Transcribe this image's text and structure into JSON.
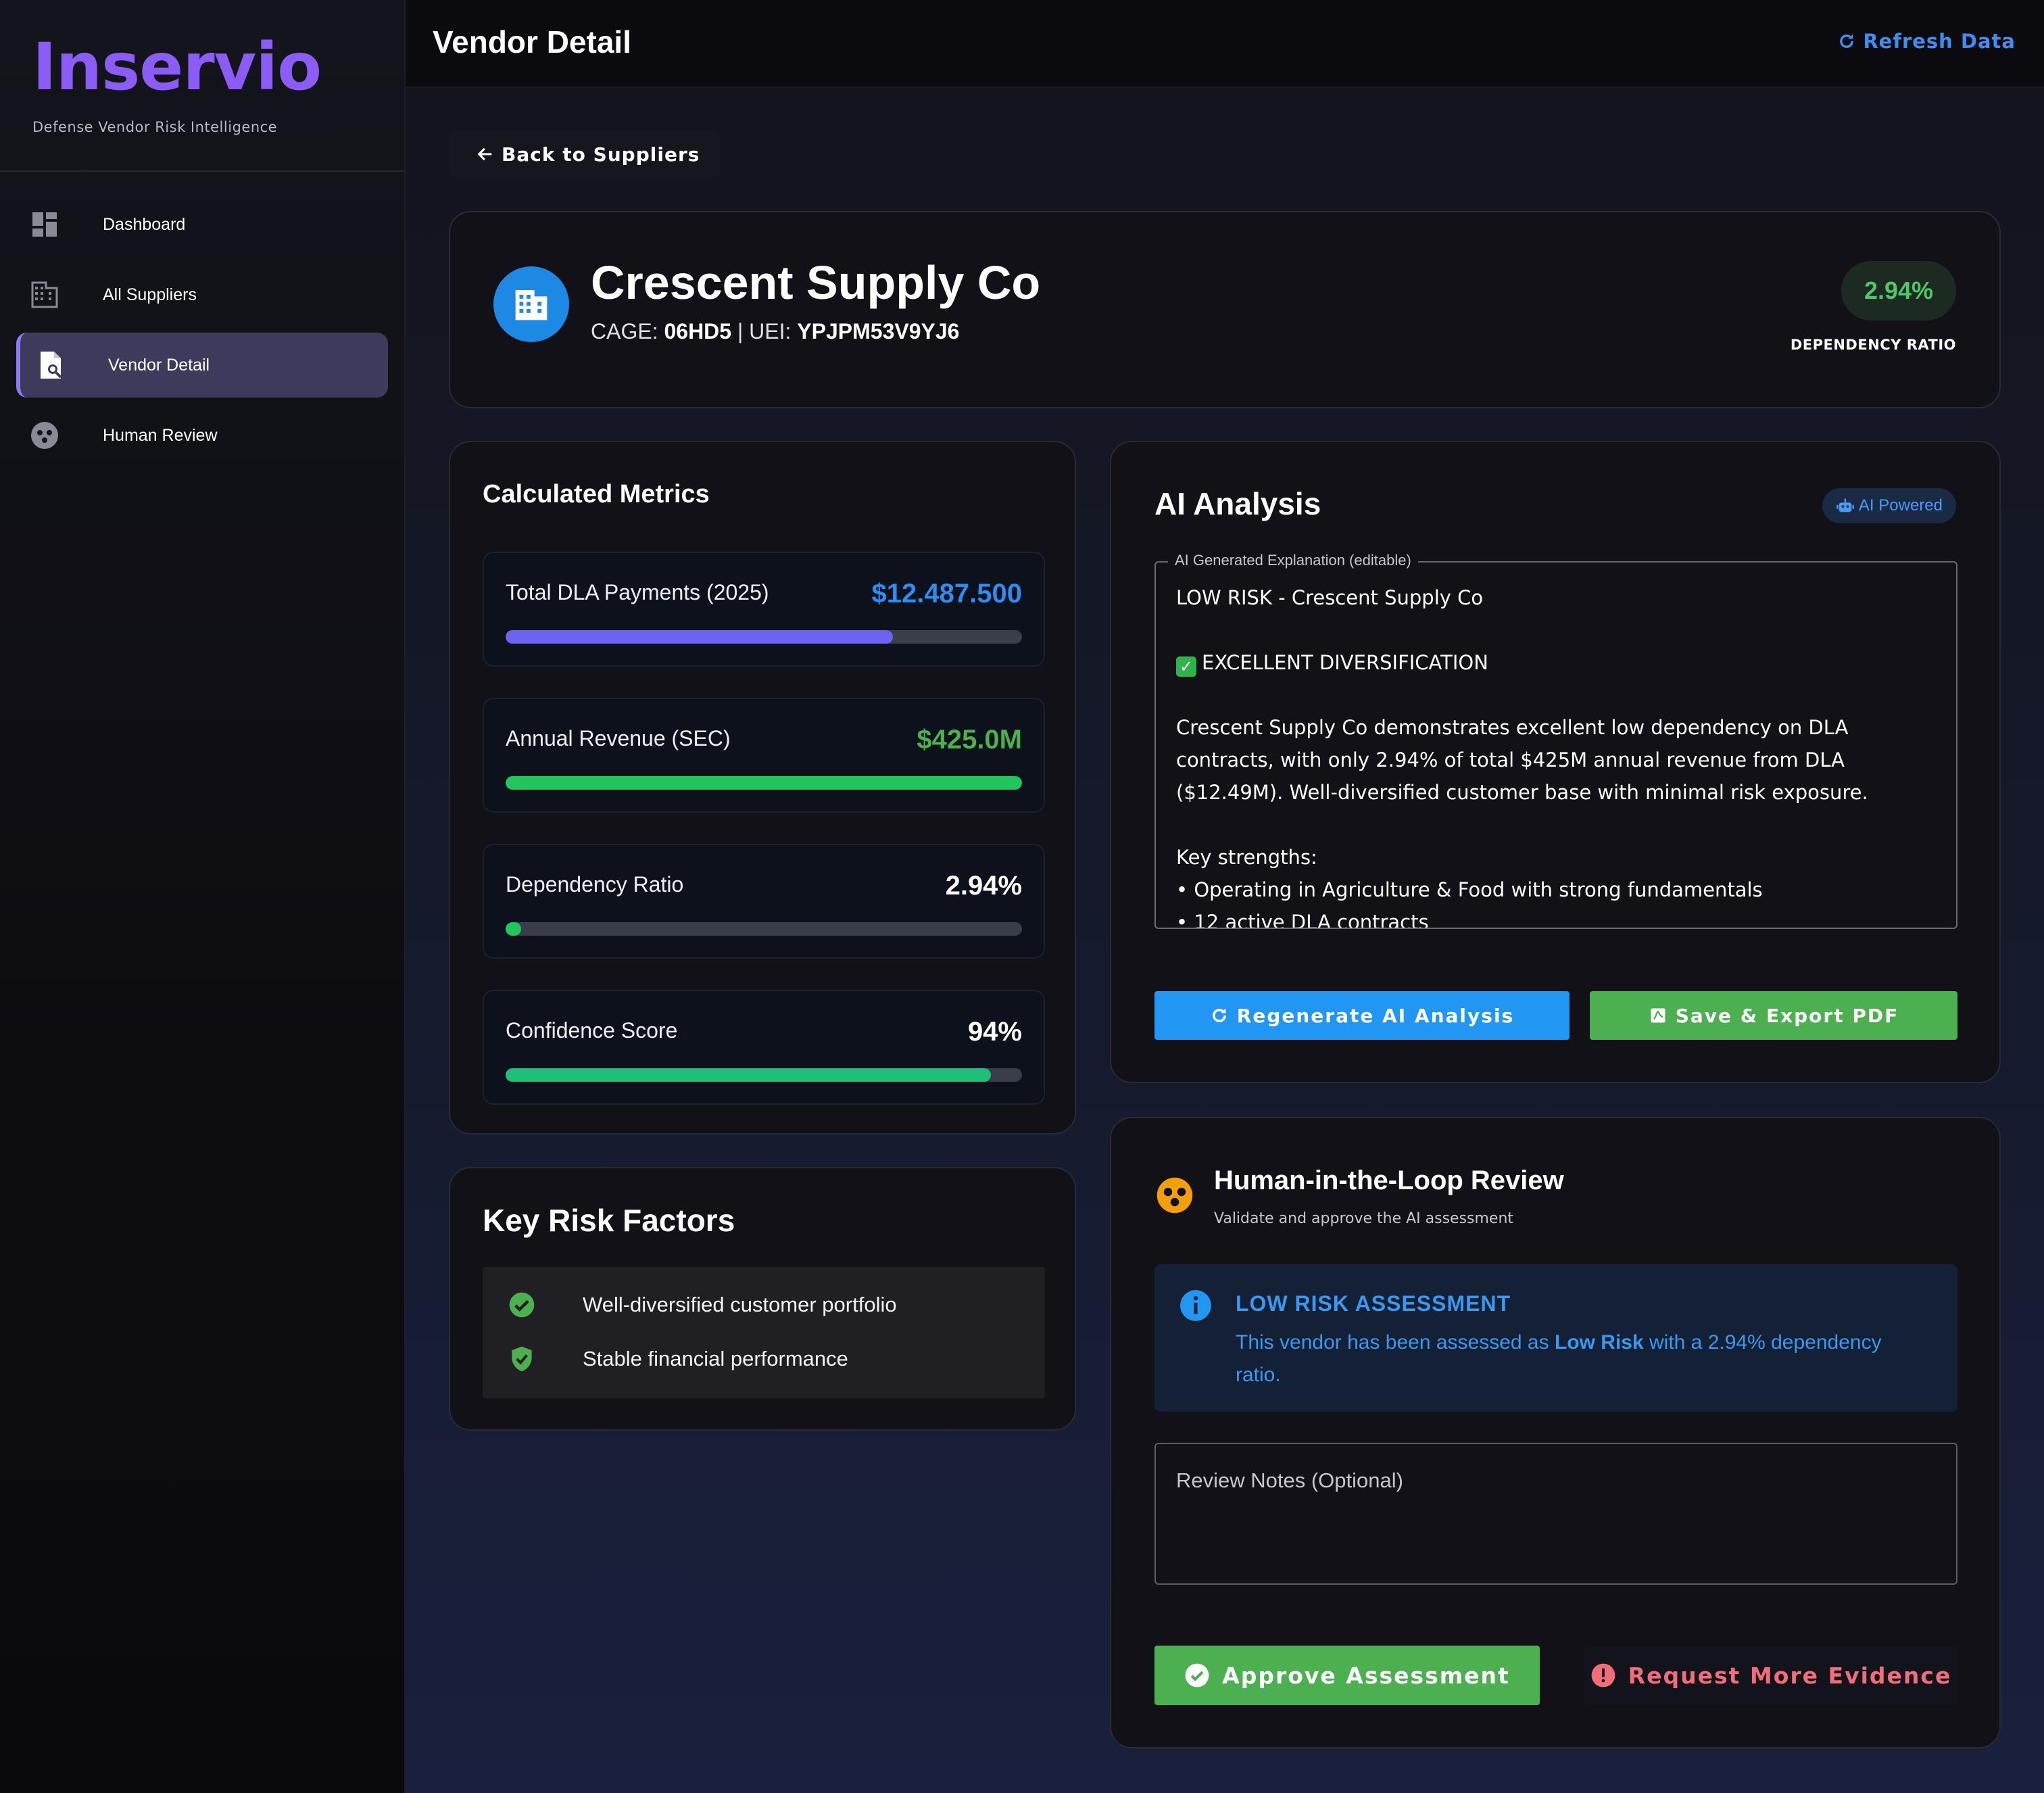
{
  "brand": {
    "name": "Inservio",
    "tagline": "Defense Vendor Risk Intelligence"
  },
  "sidebar": {
    "items": [
      {
        "label": "Dashboard",
        "icon": "dashboard-icon",
        "active": false
      },
      {
        "label": "All Suppliers",
        "icon": "building-icon",
        "active": false
      },
      {
        "label": "Vendor Detail",
        "icon": "document-search-icon",
        "active": true
      },
      {
        "label": "Human Review",
        "icon": "face-icon",
        "active": false
      }
    ]
  },
  "header": {
    "title": "Vendor Detail",
    "refresh_label": "Refresh Data"
  },
  "back_label": "Back to Suppliers",
  "vendor": {
    "name": "Crescent Supply Co",
    "cage_label": "CAGE:",
    "cage": "06HD5",
    "separator": "|",
    "uei_label": "UEI:",
    "uei": "YPJPM53V9YJ6",
    "dependency_ratio": "2.94%",
    "dependency_ratio_label": "DEPENDENCY RATIO"
  },
  "metrics": {
    "title": "Calculated Metrics",
    "items": [
      {
        "label": "Total DLA Payments (2025)",
        "value": "$12.487.500",
        "progress": 0.75,
        "color": "#2f8cf0",
        "bar": "#6c63f0"
      },
      {
        "label": "Annual Revenue (SEC)",
        "value": "$425.0M",
        "progress": 1.0,
        "color": "#4caf50",
        "bar": "#22c55e"
      },
      {
        "label": "Dependency Ratio",
        "value": "2.94%",
        "progress": 0.0294,
        "color": "#ffffff",
        "bar": "#22c55e"
      },
      {
        "label": "Confidence Score",
        "value": "94%",
        "progress": 0.94,
        "color": "#ffffff",
        "bar": "#1fbf7a"
      }
    ]
  },
  "risk_factors": {
    "title": "Key Risk Factors",
    "items": [
      {
        "text": "Well-diversified customer portfolio",
        "icon": "check-circle-icon"
      },
      {
        "text": "Stable financial performance",
        "icon": "shield-check-icon"
      }
    ]
  },
  "ai": {
    "title": "AI Analysis",
    "badge": "AI Powered",
    "field_label": "AI Generated Explanation (editable)",
    "line1": "LOW RISK - Crescent Supply Co",
    "line2": "EXCELLENT DIVERSIFICATION",
    "para": "Crescent Supply Co demonstrates excellent low dependency on DLA contracts, with only 2.94% of total $425M annual revenue from DLA ($12.49M). Well-diversified customer base with minimal risk exposure.",
    "strengths_title": "Key strengths:",
    "strength1": "• Operating in Agriculture & Food with strong fundamentals",
    "strength2": "• 12 active DLA contracts",
    "regenerate_label": "Regenerate AI Analysis",
    "export_label": "Save & Export PDF"
  },
  "review": {
    "title": "Human-in-the-Loop Review",
    "subtitle": "Validate and approve the AI assessment",
    "alert_title": "LOW RISK ASSESSMENT",
    "alert_pre": "This vendor has been assessed as ",
    "alert_bold": "Low Risk",
    "alert_post": " with a 2.94% dependency ratio.",
    "notes_placeholder": "Review Notes (Optional)",
    "approve_label": "Approve Assessment",
    "request_label": "Request More Evidence"
  }
}
